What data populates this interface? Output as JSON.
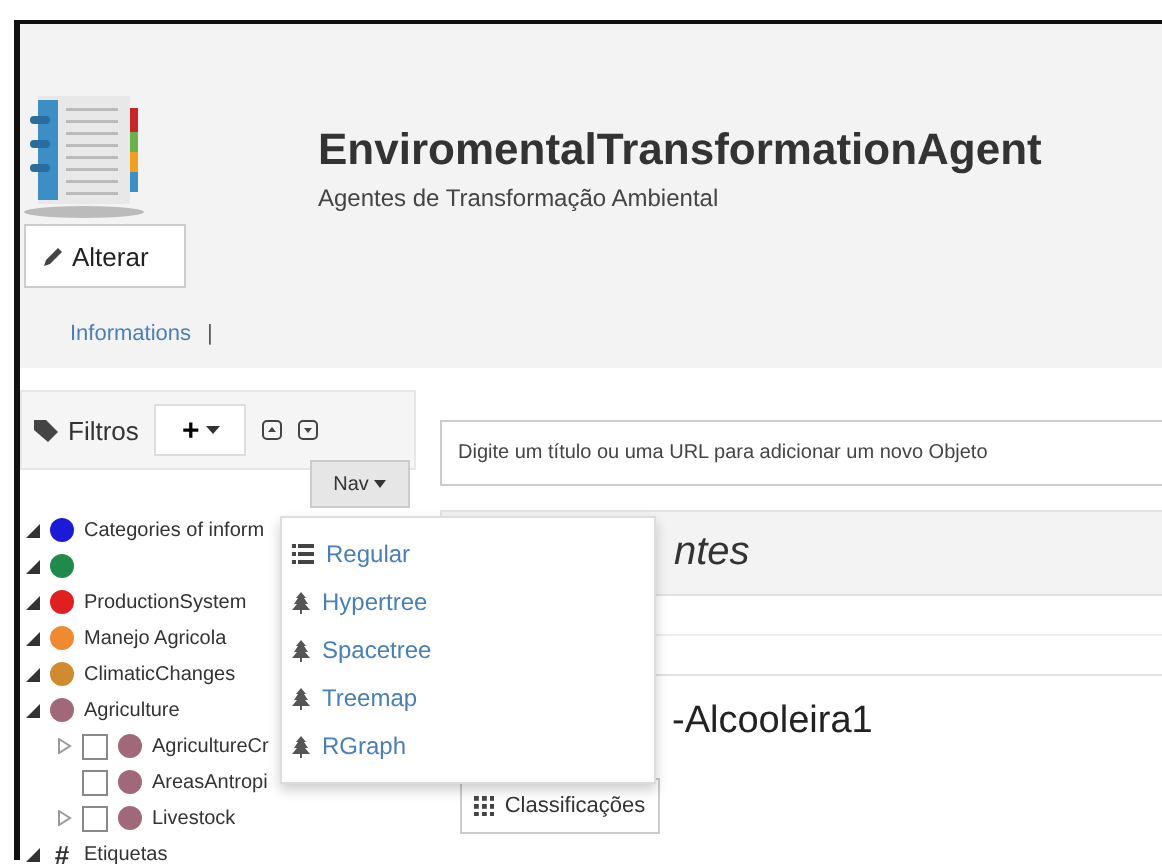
{
  "header": {
    "title": "EnviromentalTransformationAgent",
    "subtitle": "Agentes de Transformação Ambiental",
    "edit_button": "Alterar",
    "links": [
      "Informations"
    ],
    "separator": "|"
  },
  "filters": {
    "label": "Filtros",
    "add_button": "+",
    "nav_button": "Nav"
  },
  "tree": [
    {
      "kind": "category",
      "label": "Categories of inform",
      "color": "#1a1ad8",
      "expanded": true
    },
    {
      "kind": "category",
      "color": "#1f8a4c",
      "expanded": true
    },
    {
      "kind": "category",
      "label": "ProductionSystem",
      "color": "#e02020",
      "expanded": true
    },
    {
      "kind": "category",
      "label": "Manejo Agricola",
      "color": "#f08a30",
      "expanded": true
    },
    {
      "kind": "category",
      "label": "ClimaticChanges",
      "color": "#d08a30",
      "expanded": true
    },
    {
      "kind": "category",
      "label": "Agriculture",
      "color": "#a06878",
      "expanded": true,
      "children": [
        {
          "label": "AgricultureCr",
          "color": "#a06878",
          "checked": false,
          "has_children": true
        },
        {
          "label": "AreasAntropi",
          "color": "#a06878",
          "checked": false,
          "has_children": false
        },
        {
          "label": "Livestock",
          "color": "#a06878",
          "checked": false,
          "has_children": true
        }
      ]
    },
    {
      "kind": "tags",
      "symbol": "#",
      "label": "Etiquetas",
      "expanded": true
    }
  ],
  "nav_menu": [
    {
      "kind": "list",
      "label": "Regular"
    },
    {
      "kind": "tree",
      "label": "Hypertree"
    },
    {
      "kind": "tree",
      "label": "Spacetree"
    },
    {
      "kind": "tree",
      "label": "Treemap"
    },
    {
      "kind": "tree",
      "label": "RGraph"
    }
  ],
  "new_object_field": {
    "placeholder": "Digite um título ou uma URL para adicionar um novo Objeto"
  },
  "panel": {
    "title": "ntes",
    "object_title": "-Alcooleira1",
    "classify_button": "Classificações"
  }
}
